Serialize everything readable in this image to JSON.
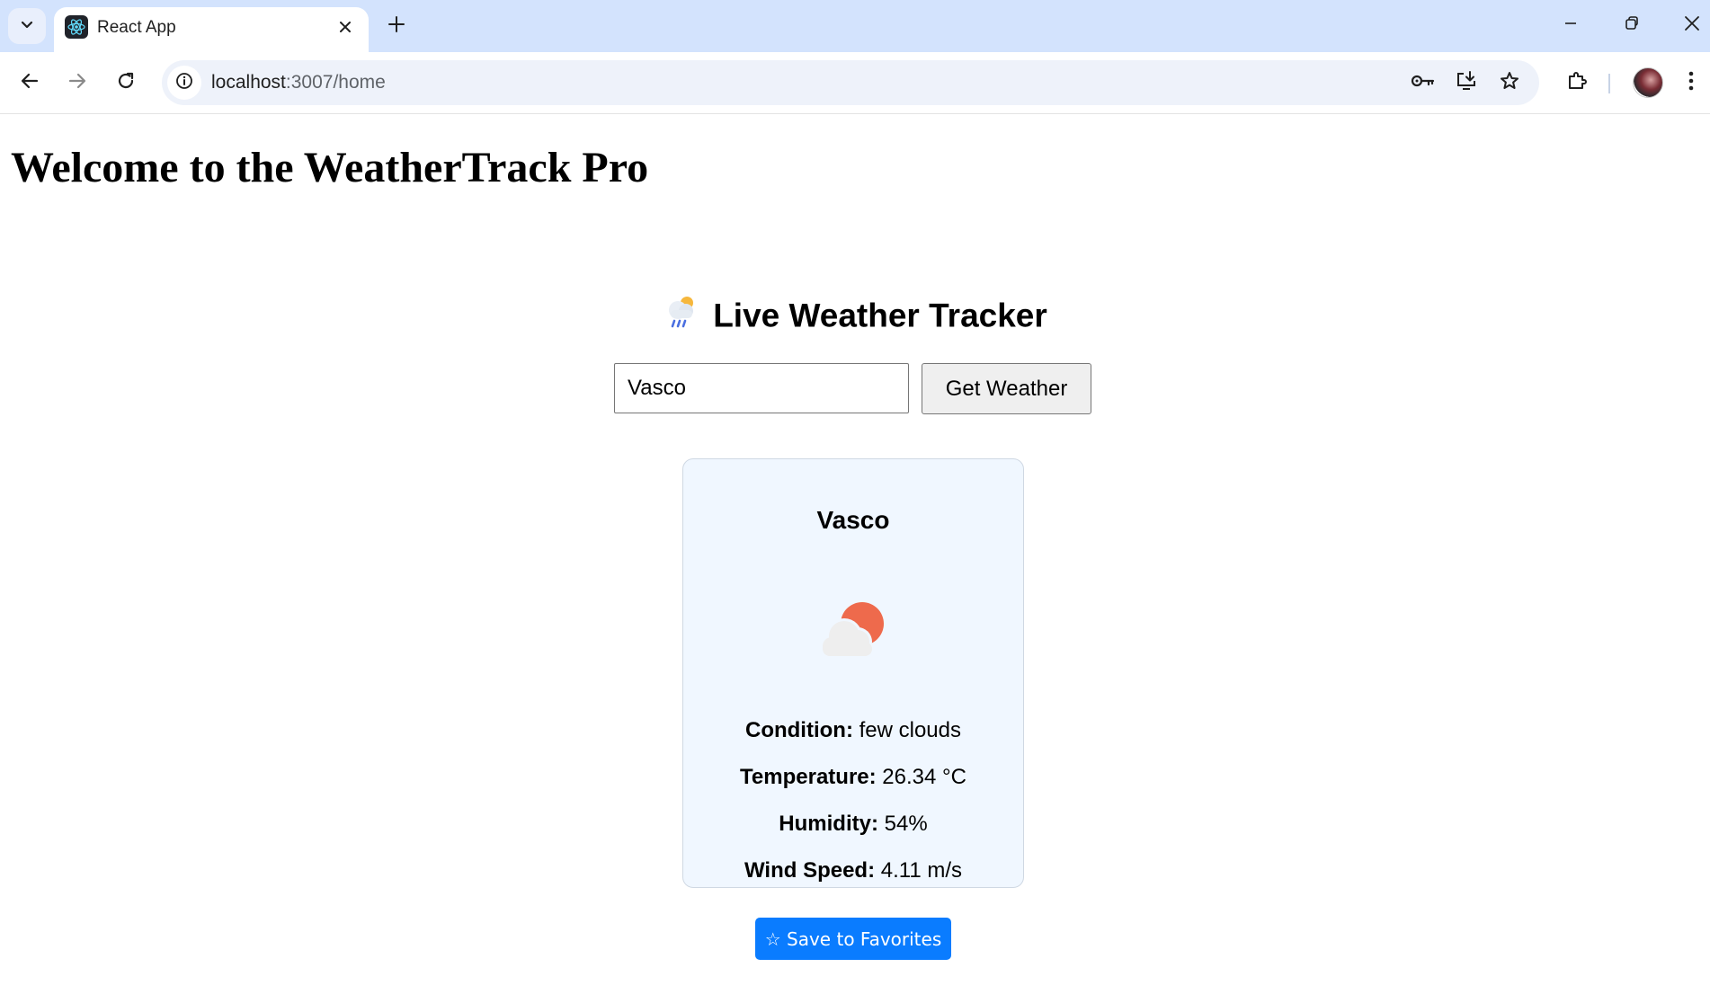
{
  "browser": {
    "tab_title": "React App",
    "url_host": "localhost",
    "url_path": ":3007/home"
  },
  "page": {
    "welcome_heading": "Welcome to the WeatherTrack Pro",
    "tracker_emoji": "🌧️",
    "tracker_title": "Live Weather Tracker",
    "search_value": "Vasco",
    "get_weather_label": "Get Weather"
  },
  "weather_card": {
    "city": "Vasco",
    "icon": "few-clouds-day-icon",
    "condition_label": "Condition:",
    "condition_value": "few clouds",
    "temperature_label": "Temperature:",
    "temperature_value": "26.34 °C",
    "humidity_label": "Humidity:",
    "humidity_value": "54%",
    "wind_label": "Wind Speed:",
    "wind_value": "4.11 m/s",
    "favorite_label": "☆ Save to Favorites"
  },
  "colors": {
    "tabstrip_bg": "#d3e3fd",
    "card_bg": "#f0f7ff",
    "favorite_button": "#0a7cff",
    "sun": "#ee6a4c"
  }
}
